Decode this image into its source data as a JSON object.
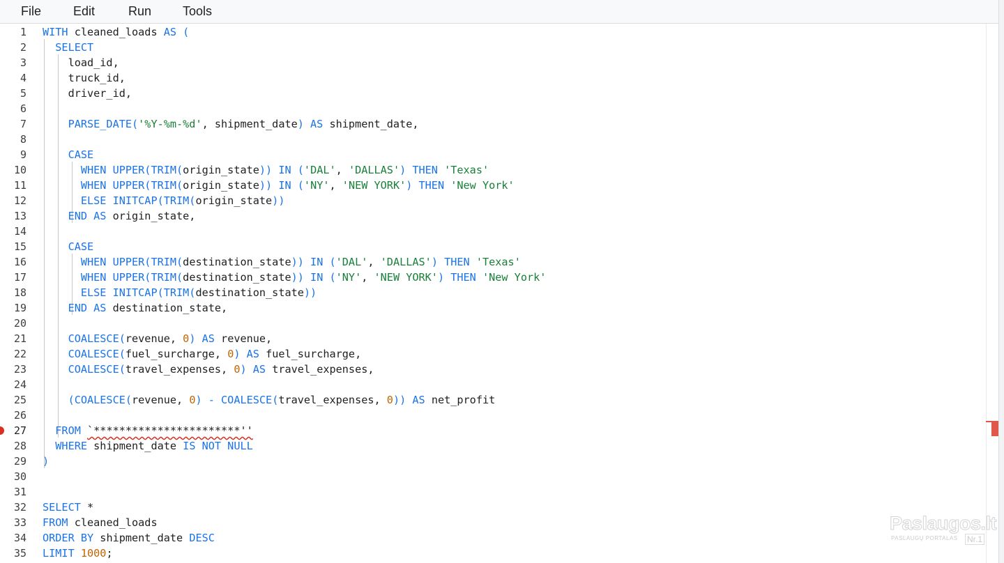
{
  "menu": [
    "File",
    "Edit",
    "Run",
    "Tools"
  ],
  "colors": {
    "keyword": "#1a73e8",
    "string": "#188038",
    "number": "#c26401",
    "identifier": "#202124",
    "error": "#d93025"
  },
  "editor": {
    "error_line": 27,
    "lines": [
      {
        "n": "1",
        "segs": [
          [
            "WITH",
            "kw"
          ],
          [
            " cleaned_loads ",
            ""
          ],
          [
            "AS (",
            "kw"
          ]
        ]
      },
      {
        "n": "2",
        "segs": [
          [
            "  SELECT",
            "kw"
          ]
        ]
      },
      {
        "n": "3",
        "segs": [
          [
            "    load_id,",
            ""
          ]
        ]
      },
      {
        "n": "4",
        "segs": [
          [
            "    truck_id,",
            ""
          ]
        ]
      },
      {
        "n": "5",
        "segs": [
          [
            "    driver_id,",
            ""
          ]
        ]
      },
      {
        "n": "6",
        "segs": []
      },
      {
        "n": "7",
        "segs": [
          [
            "    PARSE_DATE(",
            "kw"
          ],
          [
            "'%Y-%m-%d'",
            "str"
          ],
          [
            ", shipment_date",
            ""
          ],
          [
            ") AS",
            "kw"
          ],
          [
            " shipment_date,",
            ""
          ]
        ]
      },
      {
        "n": "8",
        "segs": []
      },
      {
        "n": "9",
        "segs": [
          [
            "    CASE",
            "kw"
          ]
        ]
      },
      {
        "n": "10",
        "segs": [
          [
            "      WHEN UPPER(TRIM(",
            "kw"
          ],
          [
            "origin_state",
            ""
          ],
          [
            ")) IN (",
            "kw"
          ],
          [
            "'DAL'",
            "str"
          ],
          [
            ", ",
            ""
          ],
          [
            "'DALLAS'",
            "str"
          ],
          [
            ") THEN ",
            "kw"
          ],
          [
            "'Texas'",
            "str"
          ]
        ]
      },
      {
        "n": "11",
        "segs": [
          [
            "      WHEN UPPER(TRIM(",
            "kw"
          ],
          [
            "origin_state",
            ""
          ],
          [
            ")) IN (",
            "kw"
          ],
          [
            "'NY'",
            "str"
          ],
          [
            ", ",
            ""
          ],
          [
            "'NEW YORK'",
            "str"
          ],
          [
            ") THEN ",
            "kw"
          ],
          [
            "'New York'",
            "str"
          ]
        ]
      },
      {
        "n": "12",
        "segs": [
          [
            "      ELSE INITCAP(TRIM(",
            "kw"
          ],
          [
            "origin_state",
            ""
          ],
          [
            "))",
            "kw"
          ]
        ]
      },
      {
        "n": "13",
        "segs": [
          [
            "    END AS",
            "kw"
          ],
          [
            " origin_state,",
            ""
          ]
        ]
      },
      {
        "n": "14",
        "segs": []
      },
      {
        "n": "15",
        "segs": [
          [
            "    CASE",
            "kw"
          ]
        ]
      },
      {
        "n": "16",
        "segs": [
          [
            "      WHEN UPPER(TRIM(",
            "kw"
          ],
          [
            "destination_state",
            ""
          ],
          [
            ")) IN (",
            "kw"
          ],
          [
            "'DAL'",
            "str"
          ],
          [
            ", ",
            ""
          ],
          [
            "'DALLAS'",
            "str"
          ],
          [
            ") THEN ",
            "kw"
          ],
          [
            "'Texas'",
            "str"
          ]
        ]
      },
      {
        "n": "17",
        "segs": [
          [
            "      WHEN UPPER(TRIM(",
            "kw"
          ],
          [
            "destination_state",
            ""
          ],
          [
            ")) IN (",
            "kw"
          ],
          [
            "'NY'",
            "str"
          ],
          [
            ", ",
            ""
          ],
          [
            "'NEW YORK'",
            "str"
          ],
          [
            ") THEN ",
            "kw"
          ],
          [
            "'New York'",
            "str"
          ]
        ]
      },
      {
        "n": "18",
        "segs": [
          [
            "      ELSE INITCAP(TRIM(",
            "kw"
          ],
          [
            "destination_state",
            ""
          ],
          [
            "))",
            "kw"
          ]
        ]
      },
      {
        "n": "19",
        "segs": [
          [
            "    END AS",
            "kw"
          ],
          [
            " destination_state,",
            ""
          ]
        ]
      },
      {
        "n": "20",
        "segs": []
      },
      {
        "n": "21",
        "segs": [
          [
            "    COALESCE(",
            "kw"
          ],
          [
            "revenue, ",
            ""
          ],
          [
            "0",
            "num"
          ],
          [
            ") AS",
            "kw"
          ],
          [
            " revenue,",
            ""
          ]
        ]
      },
      {
        "n": "22",
        "segs": [
          [
            "    COALESCE(",
            "kw"
          ],
          [
            "fuel_surcharge, ",
            ""
          ],
          [
            "0",
            "num"
          ],
          [
            ") AS",
            "kw"
          ],
          [
            " fuel_surcharge,",
            ""
          ]
        ]
      },
      {
        "n": "23",
        "segs": [
          [
            "    COALESCE(",
            "kw"
          ],
          [
            "travel_expenses, ",
            ""
          ],
          [
            "0",
            "num"
          ],
          [
            ") AS",
            "kw"
          ],
          [
            " travel_expenses,",
            ""
          ]
        ]
      },
      {
        "n": "24",
        "segs": []
      },
      {
        "n": "25",
        "segs": [
          [
            "    (COALESCE(",
            "kw"
          ],
          [
            "revenue, ",
            ""
          ],
          [
            "0",
            "num"
          ],
          [
            ") - COALESCE(",
            "kw"
          ],
          [
            "travel_expenses, ",
            ""
          ],
          [
            "0",
            "num"
          ],
          [
            ")) AS",
            "kw"
          ],
          [
            " net_profit",
            ""
          ]
        ]
      },
      {
        "n": "26",
        "segs": []
      },
      {
        "n": "27",
        "segs": [
          [
            "  FROM ",
            "kw"
          ],
          [
            "`***********************''",
            "err"
          ]
        ]
      },
      {
        "n": "28",
        "segs": [
          [
            "  WHERE",
            "kw"
          ],
          [
            " shipment_date ",
            ""
          ],
          [
            "IS NOT NULL",
            "kw"
          ]
        ]
      },
      {
        "n": "29",
        "segs": [
          [
            ")",
            "kw"
          ]
        ]
      },
      {
        "n": "30",
        "segs": []
      },
      {
        "n": "31",
        "segs": []
      },
      {
        "n": "32",
        "segs": [
          [
            "SELECT",
            "kw"
          ],
          [
            " *",
            ""
          ]
        ]
      },
      {
        "n": "33",
        "segs": [
          [
            "FROM",
            "kw"
          ],
          [
            " cleaned_loads",
            ""
          ]
        ]
      },
      {
        "n": "34",
        "segs": [
          [
            "ORDER BY",
            "kw"
          ],
          [
            " shipment_date ",
            ""
          ],
          [
            "DESC",
            "kw"
          ]
        ]
      },
      {
        "n": "35",
        "segs": [
          [
            "LIMIT ",
            "kw"
          ],
          [
            "1000",
            "num"
          ],
          [
            ";",
            ""
          ]
        ]
      }
    ]
  },
  "watermark": {
    "brand": "Paslaugos.lt",
    "tagline": "PASLAUGŲ PORTALAS",
    "rank": "Nr.1"
  }
}
